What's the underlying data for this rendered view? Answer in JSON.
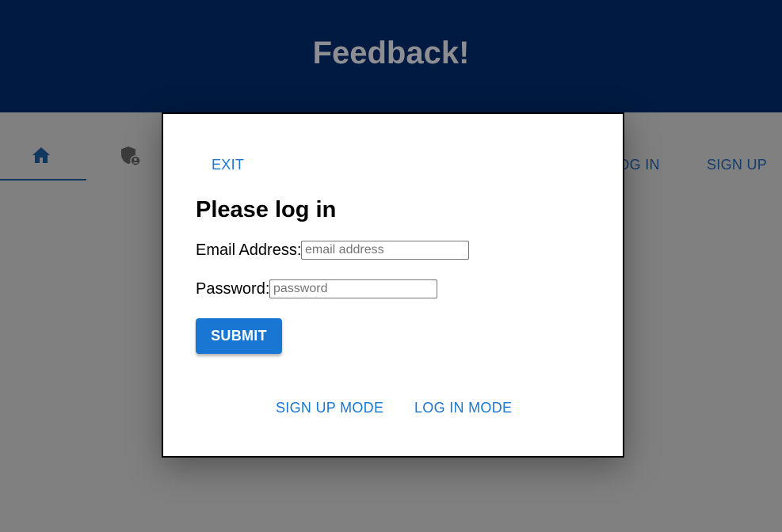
{
  "header": {
    "title": "Feedback!"
  },
  "navbar": {
    "home_icon": "home-icon",
    "admin_icon": "admin-shield-icon",
    "login_label": "LOG IN",
    "signup_label": "SIGN UP"
  },
  "modal": {
    "exit_label": "EXIT",
    "title": "Please log in",
    "email_label": "Email Address:",
    "email_placeholder": "email address",
    "email_value": "",
    "password_label": "Password:",
    "password_placeholder": "password",
    "password_value": "",
    "submit_label": "SUBMIT",
    "signup_mode_label": "SIGN UP MODE",
    "login_mode_label": "LOG IN MODE"
  },
  "colors": {
    "header_bg": "#011a41",
    "header_text": "#8e8e92",
    "overlay_bg": "#808080",
    "accent": "#1976d2",
    "nav_text": "#143c6a"
  }
}
